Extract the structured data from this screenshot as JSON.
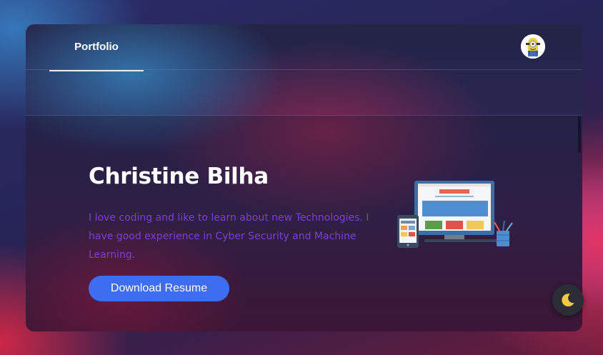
{
  "navbar": {
    "brand": "Portfolio",
    "avatar_alt": "minion-avatar"
  },
  "hero": {
    "name": "Christine Bilha",
    "description": "I love coding and like to learn about new Technologies. I have good experience in Cyber Security and Machine Learning.",
    "resume_button": "Download Resume",
    "illustration": "web-design-devices-illustration"
  },
  "theme_toggle": {
    "icon": "moon-icon",
    "icon_color": "#f6c744"
  },
  "colors": {
    "accent": "#3d6df0",
    "description_text": "#7b3fd2",
    "card_background": "#2a2652"
  }
}
